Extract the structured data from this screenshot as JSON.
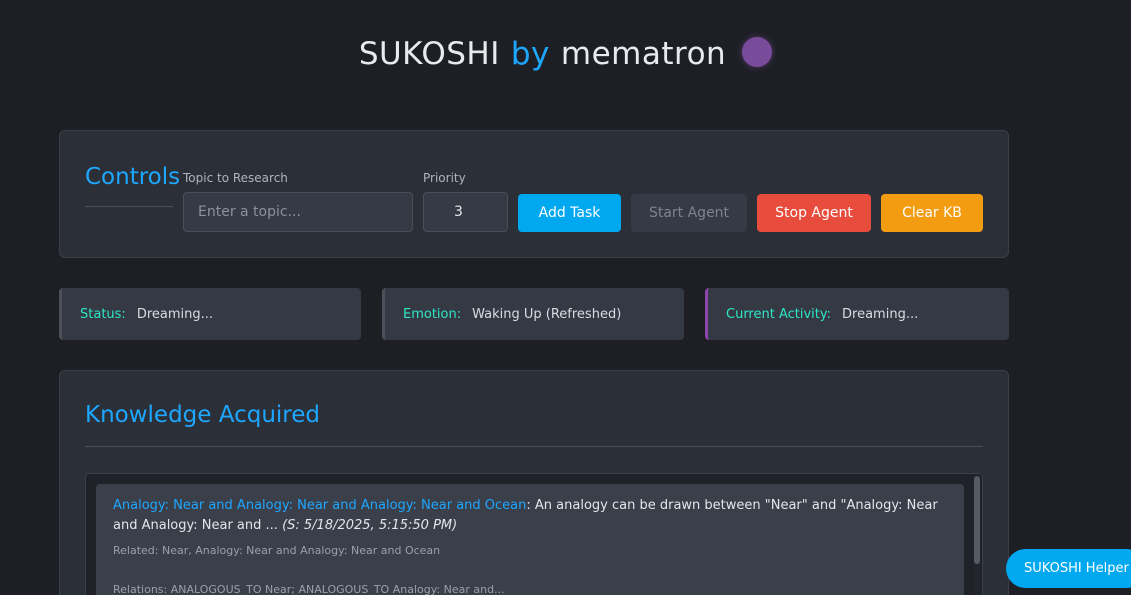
{
  "header": {
    "title_part1": "SUKOSHI",
    "title_by": "by",
    "title_part2": "mematron",
    "orb_color": "#7a4b9a"
  },
  "controls": {
    "title": "Controls",
    "topic_label": "Topic to Research",
    "topic_placeholder": "Enter a topic...",
    "priority_label": "Priority",
    "priority_value": "3",
    "buttons": {
      "add_task": "Add Task",
      "start_agent": "Start Agent",
      "stop_agent": "Stop Agent",
      "clear_kb": "Clear KB"
    }
  },
  "status_cards": [
    {
      "key": "Status:",
      "value": "Dreaming..."
    },
    {
      "key": "Emotion:",
      "value": "Waking Up (Refreshed)"
    },
    {
      "key": "Current Activity:",
      "value": "Dreaming..."
    }
  ],
  "knowledge": {
    "title": "Knowledge Acquired",
    "entries": [
      {
        "topic": "Analogy: Near and Analogy: Near and Analogy: Near and Ocean",
        "summary": ": An analogy can be drawn between \"Near\" and \"Analogy: Near and Analogy: Near and ... ",
        "source": "(S: 5/18/2025, 5:15:50 PM)",
        "related": "Related: Near, Analogy: Near and Analogy: Near and Ocean",
        "relations": "Relations: ANALOGOUS_TO Near; ANALOGOUS_TO Analogy: Near and..."
      }
    ]
  },
  "helper": {
    "label": "SUKOSHI Helper"
  },
  "colors": {
    "background": "#1d1f25",
    "panel": "#2b2f38",
    "accent_blue": "#1ea7ff",
    "teal_key": "#2ee6c6",
    "add_button": "#00a8f0",
    "stop_button": "#e74c3c",
    "clear_button": "#f39c12",
    "activity_border": "#8e44ad"
  }
}
